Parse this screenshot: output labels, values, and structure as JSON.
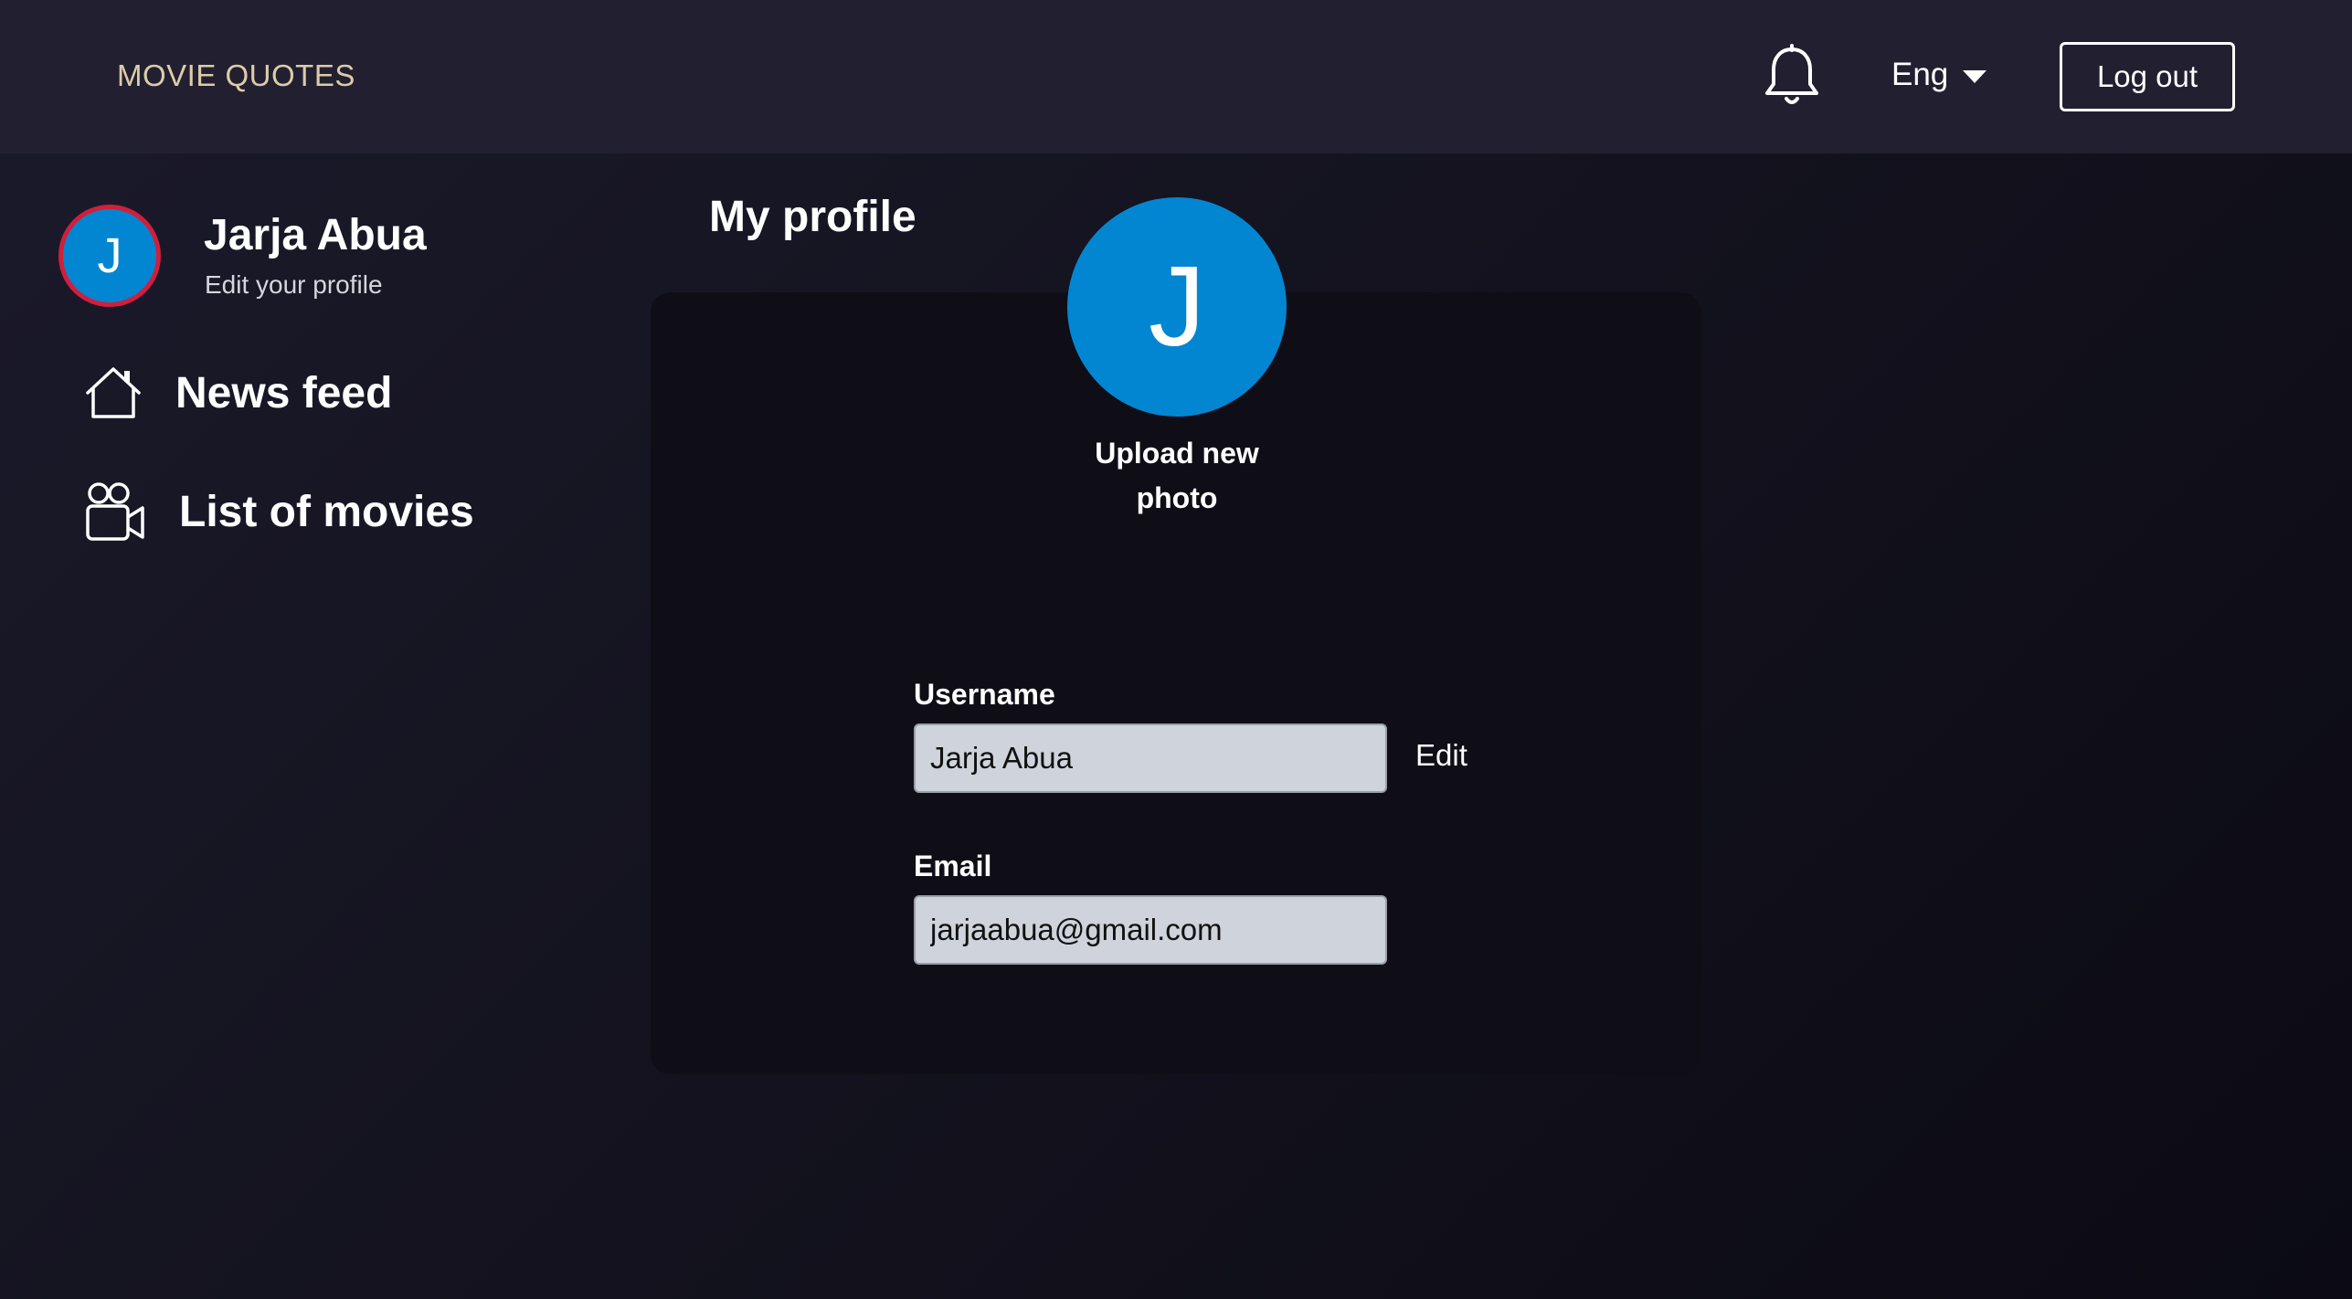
{
  "header": {
    "brand": "MOVIE QUOTES",
    "language": "Eng",
    "logout_label": "Log out"
  },
  "sidebar": {
    "avatar_initial": "J",
    "user_name": "Jarja Abua",
    "edit_profile_label": "Edit your profile",
    "items": [
      {
        "label": "News feed",
        "icon": "house-icon"
      },
      {
        "label": "List of movies",
        "icon": "movie-camera-icon"
      }
    ]
  },
  "main": {
    "title": "My profile",
    "avatar_initial": "J",
    "upload_line1": "Upload new",
    "upload_line2": "photo",
    "username": {
      "label": "Username",
      "value": "Jarja Abua",
      "edit_label": "Edit"
    },
    "email": {
      "label": "Email",
      "value": "jarjaabua@gmail.com"
    }
  },
  "colors": {
    "brand": "#ddccaa",
    "avatar_bg": "#0386d1",
    "avatar_ring": "#d01f3c",
    "header_bg": "#222030",
    "card_bg": "#0f0e17"
  }
}
